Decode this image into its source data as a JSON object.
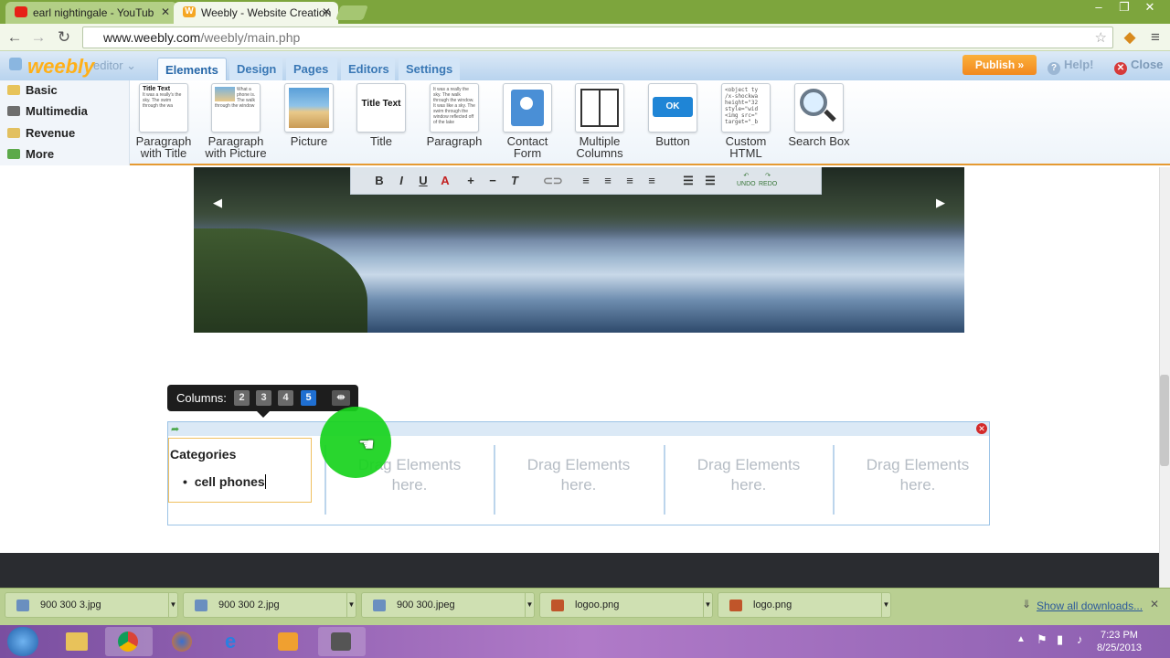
{
  "browser": {
    "tabs": [
      {
        "title": "earl nightingale - YouTub",
        "favicon": "youtube-icon"
      },
      {
        "title": "Weebly - Website Creation",
        "favicon": "weebly-icon"
      }
    ],
    "url_host": "www.weebly.com",
    "url_path": "/weebly/main.php"
  },
  "weebly": {
    "logo": "weebly",
    "editor_label": "editor",
    "tabs": [
      "Elements",
      "Design",
      "Pages",
      "Editors",
      "Settings"
    ],
    "active_tab": "Elements",
    "publish_label": "Publish »",
    "help_label": "Help!",
    "close_label": "Close",
    "categories": [
      "Basic",
      "Multimedia",
      "Revenue",
      "More"
    ],
    "elements": [
      {
        "label": "Paragraph with Title",
        "l1": "Paragraph",
        "l2": "with Title",
        "thumb_text": "Title Text"
      },
      {
        "label": "Paragraph with Picture",
        "l1": "Paragraph",
        "l2": "with Picture"
      },
      {
        "label": "Picture",
        "l1": "Picture",
        "l2": ""
      },
      {
        "label": "Title",
        "l1": "Title",
        "l2": "",
        "thumb_text": "Title Text"
      },
      {
        "label": "Paragraph",
        "l1": "Paragraph",
        "l2": ""
      },
      {
        "label": "Contact Form",
        "l1": "Contact",
        "l2": "Form"
      },
      {
        "label": "Multiple Columns",
        "l1": "Multiple",
        "l2": "Columns"
      },
      {
        "label": "Button",
        "l1": "Button",
        "l2": "",
        "thumb_text": "OK"
      },
      {
        "label": "Custom HTML",
        "l1": "Custom",
        "l2": "HTML"
      },
      {
        "label": "Search Box",
        "l1": "Search Box",
        "l2": ""
      }
    ]
  },
  "format_toolbar": {
    "buttons": [
      "B",
      "I",
      "U",
      "A",
      "+",
      "−",
      "T"
    ],
    "undo": "UNDO",
    "redo": "REDO"
  },
  "columns_popup": {
    "label": "Columns:",
    "options": [
      "2",
      "3",
      "4",
      "5"
    ],
    "selected": "5"
  },
  "content": {
    "categories_heading": "Categories",
    "category_item": "cell phones",
    "drag_text_1": "Drag Elements",
    "drag_text_2": "here."
  },
  "downloads": {
    "items": [
      "900 300 3.jpg",
      "900 300 2.jpg",
      "900 300.jpeg",
      "logoo.png",
      "logo.png"
    ],
    "show_all": "Show all downloads..."
  },
  "taskbar": {
    "time": "7:23 PM",
    "date": "8/25/2013"
  },
  "colors": {
    "chrome_frame": "#7da53d",
    "weebly_blue": "#2466a8",
    "publish_orange": "#f2891f",
    "selected_column": "#1f6fd1"
  }
}
